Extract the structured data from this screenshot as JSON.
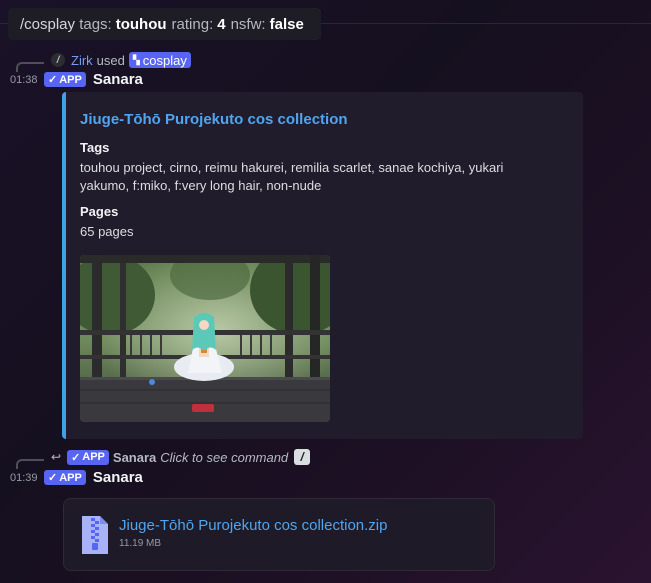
{
  "command_bar": {
    "command": "/cosplay",
    "tags_key": "tags:",
    "tags_value": "touhou",
    "rating_key": "rating:",
    "rating_value": "4",
    "nsfw_key": "nsfw:",
    "nsfw_value": "false"
  },
  "message1": {
    "reply": {
      "user": "Zirk",
      "used": "used",
      "command": "cosplay",
      "icon": "slash-command-icon"
    },
    "timestamp": "01:38",
    "badge": "APP",
    "author": "Sanara",
    "embed": {
      "accent_color": "#3fa1e6",
      "title": "Jiuge-Tōhō Purojekuto cos collection",
      "fields": [
        {
          "name": "Tags",
          "value": "touhou project, cirno, reimu hakurei, remilia scarlet, sanae kochiya, yukari yakumo, f:miko, f:very long hair, non-nude"
        },
        {
          "name": "Pages",
          "value": "65 pages"
        }
      ]
    }
  },
  "message2": {
    "reply": {
      "badge": "APP",
      "user": "Sanara",
      "hint": "Click to see command",
      "icon": "slash-command-icon"
    },
    "timestamp": "01:39",
    "badge": "APP",
    "author": "Sanara",
    "attachment": {
      "icon": "zip-file-icon",
      "filename": "Jiuge-Tōhō Purojekuto cos collection.zip",
      "size": "11.19 MB"
    }
  },
  "colors": {
    "blurple": "#5865f2",
    "link": "#4fa5ef"
  }
}
